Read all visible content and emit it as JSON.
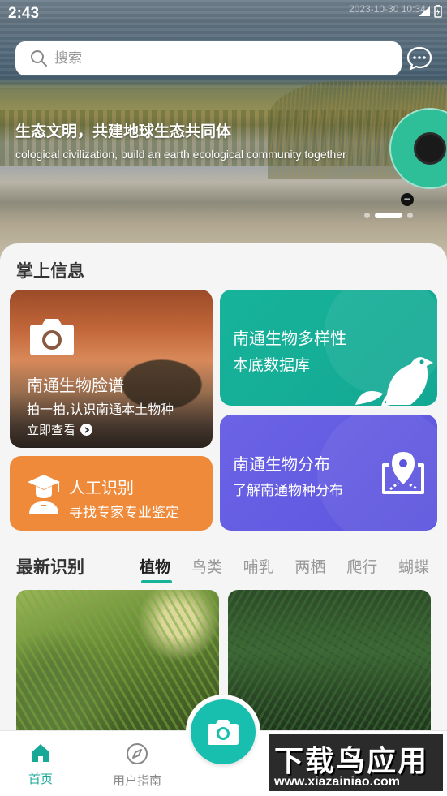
{
  "status": {
    "time": "2:43",
    "date": "2023-10-30 10:34"
  },
  "search": {
    "placeholder": "搜索"
  },
  "banner": {
    "title": "生态文明，共建地球生态共同体",
    "subtitle": "cological civilization, build an earth ecological community together"
  },
  "section": {
    "title": "掌上信息"
  },
  "cards": {
    "face": {
      "title": "南通生物脸谱",
      "desc": "拍一拍,认识南通本土物种",
      "link": "立即查看"
    },
    "database": {
      "line1": "南通生物多样性",
      "line2": "本底数据库"
    },
    "expert": {
      "title": "人工识别",
      "desc": "寻找专家专业鉴定"
    },
    "distribution": {
      "title": "南通生物分布",
      "desc": "了解南通物种分布"
    }
  },
  "recent": {
    "title": "最新识别",
    "tabs": [
      "植物",
      "鸟类",
      "哺乳",
      "两栖",
      "爬行",
      "蝴蝶"
    ],
    "active_tab": "植物"
  },
  "nav": {
    "home": "首页",
    "guide": "用户指南"
  },
  "watermark": {
    "line1": "下载鸟应用",
    "line2": "www.xiazainiao.com"
  },
  "colors": {
    "accent": "#16b39a",
    "db_card": "#13a893",
    "expert_card": "#ef8a3a",
    "distribution_card": "#5c55dd",
    "fab": "#18bfae"
  },
  "icons": [
    "search-icon",
    "message-icon",
    "camera-icon",
    "bird-icon",
    "graduate-icon",
    "map-pin-icon",
    "home-icon",
    "compass-icon"
  ]
}
